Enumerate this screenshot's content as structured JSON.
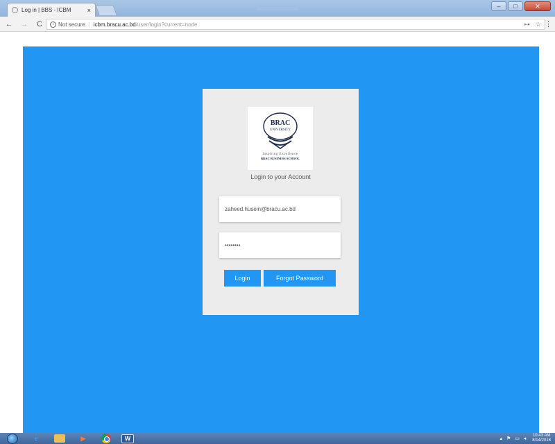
{
  "browser": {
    "tab_title": "Log in | BBS - ICBM",
    "tab_close": "×",
    "security_label": "Not secure",
    "url_host": "icbm.bracu.ac.bd",
    "url_path": "/user/login?current=node",
    "back_glyph": "←",
    "forward_glyph": "→",
    "reload_glyph": "C",
    "key_glyph": "⊶",
    "star_glyph": "☆",
    "menu_glyph": "⋮",
    "window_buttons": {
      "minimize": "–",
      "maximize": "□",
      "close": "✕"
    }
  },
  "login": {
    "logo": {
      "line1": "BRAC",
      "line2": "UNIVERSITY",
      "tagline": "Inspiring Excellence",
      "school": "BRAC BUSINESS SCHOOL"
    },
    "heading": "Login to your Account",
    "email_value": "zaheed.husein@bracu.ac.bd",
    "password_value": "••••••••",
    "login_button": "Login",
    "forgot_button": "Forgot Password"
  },
  "taskbar": {
    "media_label": "▶",
    "word_label": "W",
    "tray_icons": "▴ ⚑ ▭ ◂",
    "time": "10:43 AM",
    "date": "8/14/2018"
  },
  "colors": {
    "page_background": "#2196f3",
    "card_background": "#ececec",
    "button": "#2196f3",
    "button_text": "#ffffff",
    "logo_navy": "#1b2a4a"
  }
}
